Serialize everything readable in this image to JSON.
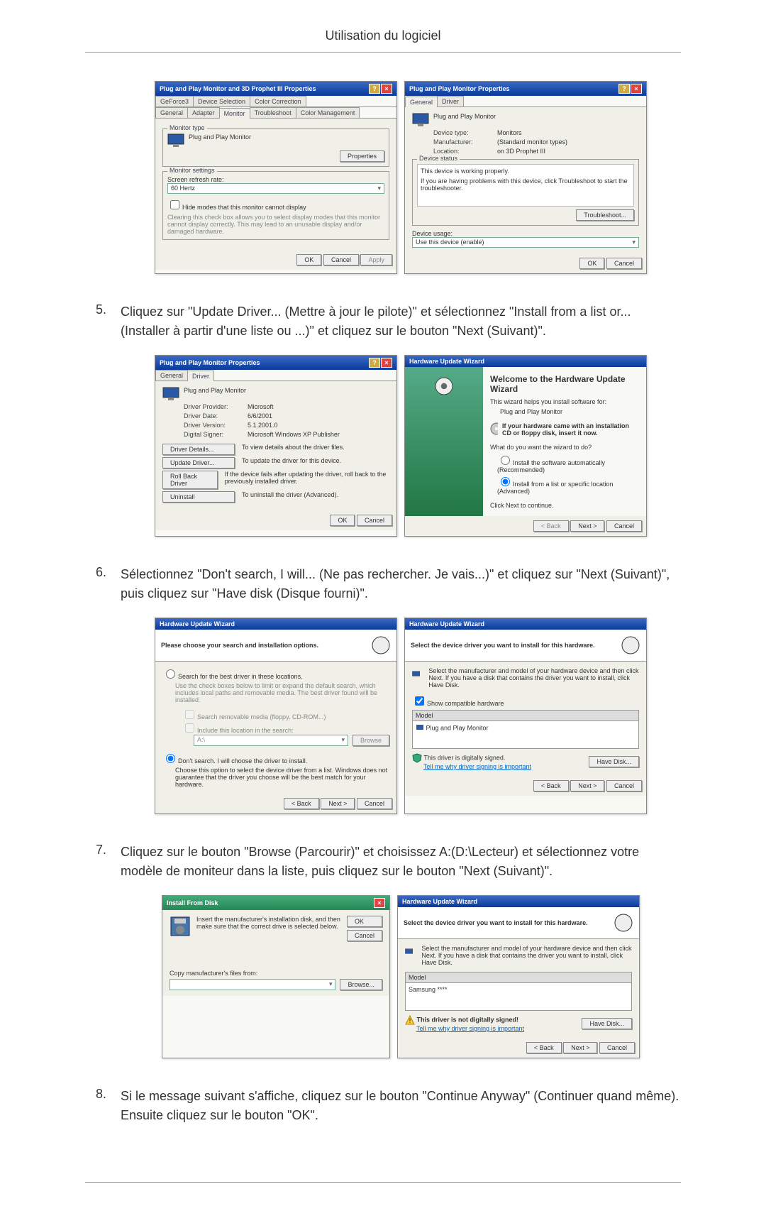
{
  "header": "Utilisation du logiciel",
  "steps": {
    "s5": {
      "n": "5.",
      "t": "Cliquez sur \"Update Driver... (Mettre à jour le pilote)\" et sélectionnez \"Install from a list or... (Installer à partir d'une liste ou ...)\" et cliquez sur le bouton \"Next (Suivant)\"."
    },
    "s6": {
      "n": "6.",
      "t": "Sélectionnez \"Don't search, I will... (Ne pas rechercher. Je vais...)\" et cliquez sur \"Next (Suivant)\", puis cliquez sur \"Have disk (Disque fourni)\"."
    },
    "s7": {
      "n": "7.",
      "t": "Cliquez sur le bouton \"Browse (Parcourir)\" et choisissez A:(D:\\Lecteur) et sélectionnez votre modèle de moniteur dans la liste, puis cliquez sur le bouton \"Next (Suivant)\"."
    },
    "s8": {
      "n": "8.",
      "t": "Si le message suivant s'affiche, cliquez sur le bouton \"Continue Anyway\" (Continuer quand même). Ensuite cliquez sur le bouton \"OK\"."
    }
  },
  "d1": {
    "title": "Plug and Play Monitor and 3D Prophet III Properties",
    "tabs": [
      "GeForce3",
      "Device Selection",
      "Color Correction",
      "General",
      "Adapter",
      "Monitor",
      "Troubleshoot",
      "Color Management"
    ],
    "montype_label": "Monitor type",
    "montype_value": "Plug and Play Monitor",
    "prop_btn": "Properties",
    "settings_label": "Monitor settings",
    "refresh_label": "Screen refresh rate:",
    "refresh_value": "60 Hertz",
    "hide_chk": "Hide modes that this monitor cannot display",
    "hide_txt": "Clearing this check box allows you to select display modes that this monitor cannot display correctly. This may lead to an unusable display and/or damaged hardware.",
    "ok": "OK",
    "cancel": "Cancel",
    "apply": "Apply"
  },
  "d2": {
    "title": "Plug and Play Monitor Properties",
    "tabs": [
      "General",
      "Driver"
    ],
    "name": "Plug and Play Monitor",
    "devtype_k": "Device type:",
    "devtype_v": "Monitors",
    "manu_k": "Manufacturer:",
    "manu_v": "(Standard monitor types)",
    "loc_k": "Location:",
    "loc_v": "on 3D Prophet III",
    "status_label": "Device status",
    "status_txt1": "This device is working properly.",
    "status_txt2": "If you are having problems with this device, click Troubleshoot to start the troubleshooter.",
    "trouble": "Troubleshoot...",
    "usage_label": "Device usage:",
    "usage_value": "Use this device (enable)",
    "ok": "OK",
    "cancel": "Cancel"
  },
  "d3": {
    "title": "Plug and Play Monitor Properties",
    "tabs": [
      "General",
      "Driver"
    ],
    "name": "Plug and Play Monitor",
    "prov_k": "Driver Provider:",
    "prov_v": "Microsoft",
    "date_k": "Driver Date:",
    "date_v": "6/6/2001",
    "ver_k": "Driver Version:",
    "ver_v": "5.1.2001.0",
    "sig_k": "Digital Signer:",
    "sig_v": "Microsoft Windows XP Publisher",
    "btn1": "Driver Details...",
    "txt1": "To view details about the driver files.",
    "btn2": "Update Driver...",
    "txt2": "To update the driver for this device.",
    "btn3": "Roll Back Driver",
    "txt3": "If the device fails after updating the driver, roll back to the previously installed driver.",
    "btn4": "Uninstall",
    "txt4": "To uninstall the driver (Advanced).",
    "ok": "OK",
    "cancel": "Cancel"
  },
  "d4": {
    "title": "Hardware Update Wizard",
    "h1": "Welcome to the Hardware Update Wizard",
    "t1": "This wizard helps you install software for:",
    "t2": "Plug and Play Monitor",
    "cd": "If your hardware came with an installation CD or floppy disk, insert it now.",
    "q": "What do you want the wizard to do?",
    "r1": "Install the software automatically (Recommended)",
    "r2": "Install from a list or specific location (Advanced)",
    "t3": "Click Next to continue.",
    "back": "< Back",
    "next": "Next >",
    "cancel": "Cancel"
  },
  "d5": {
    "title": "Hardware Update Wizard",
    "h": "Please choose your search and installation options.",
    "r1": "Search for the best driver in these locations.",
    "r1t": "Use the check boxes below to limit or expand the default search, which includes local paths and removable media. The best driver found will be installed.",
    "c1": "Search removable media (floppy, CD-ROM...)",
    "c2": "Include this location in the search:",
    "loc": "A:\\",
    "browse": "Browse",
    "r2": "Don't search. I will choose the driver to install.",
    "r2t": "Choose this option to select the device driver from a list. Windows does not guarantee that the driver you choose will be the best match for your hardware.",
    "back": "< Back",
    "next": "Next >",
    "cancel": "Cancel"
  },
  "d6": {
    "title": "Hardware Update Wizard",
    "h": "Select the device driver you want to install for this hardware.",
    "t1": "Select the manufacturer and model of your hardware device and then click Next. If you have a disk that contains the driver you want to install, click Have Disk.",
    "show": "Show compatible hardware",
    "model": "Model",
    "item": "Plug and Play Monitor",
    "signed": "This driver is digitally signed.",
    "tell": "Tell me why driver signing is important",
    "have": "Have Disk...",
    "back": "< Back",
    "next": "Next >",
    "cancel": "Cancel"
  },
  "d7": {
    "title": "Install From Disk",
    "t": "Insert the manufacturer's installation disk, and then make sure that the correct drive is selected below.",
    "ok": "OK",
    "cancel": "Cancel",
    "copy": "Copy manufacturer's files from:",
    "browse": "Browse..."
  },
  "d8": {
    "title": "Hardware Update Wizard",
    "h": "Select the device driver you want to install for this hardware.",
    "t1": "Select the manufacturer and model of your hardware device and then click Next. If you have a disk that contains the driver you want to install, click Have Disk.",
    "model": "Model",
    "item": "Samsung ****",
    "notsigned": "This driver is not digitally signed!",
    "tell": "Tell me why driver signing is important",
    "have": "Have Disk...",
    "back": "< Back",
    "next": "Next >",
    "cancel": "Cancel"
  }
}
